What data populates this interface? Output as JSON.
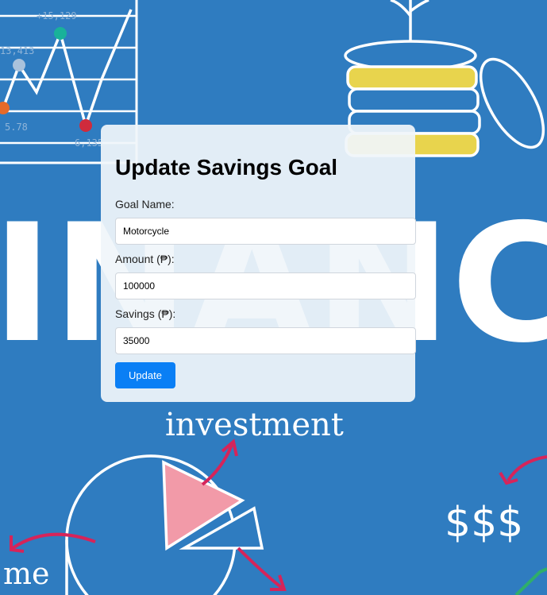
{
  "background": {
    "chart_labels": [
      "+15,129",
      "13,413",
      "5.78",
      "6,135"
    ],
    "word_investment": "investment",
    "word_dollars": "$$$",
    "word_me": "me",
    "word_finance": "INANC"
  },
  "form": {
    "title": "Update Savings Goal",
    "goal_name_label": "Goal Name:",
    "goal_name_value": "Motorcycle",
    "amount_label": "Amount (₱):",
    "amount_value": "100000",
    "savings_label": "Savings (₱):",
    "savings_value": "35000",
    "submit_label": "Update"
  },
  "colors": {
    "background": "#2f7cc0",
    "button": "#0a7ff5",
    "coin_gold": "#e8d44d",
    "arrow_red": "#d6245a"
  }
}
